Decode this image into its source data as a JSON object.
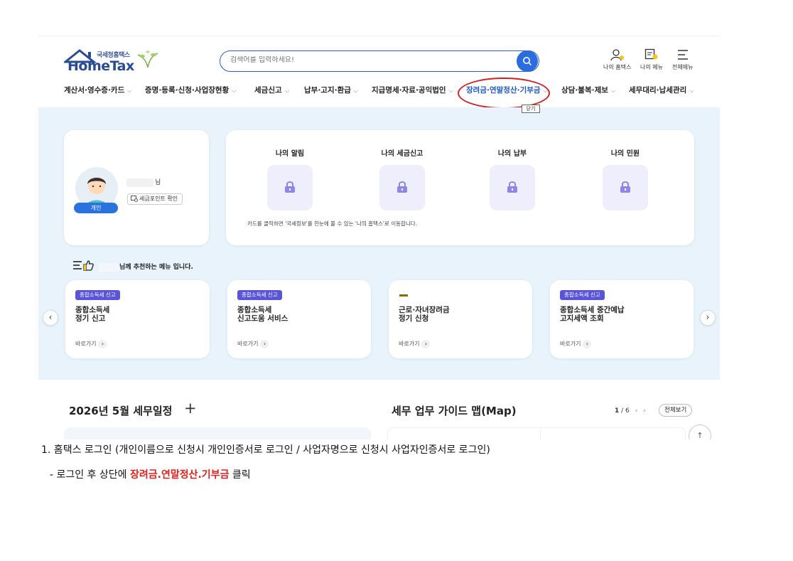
{
  "header": {
    "logo_sub": "국세청홈택스",
    "logo_main": "HomeTax",
    "search_placeholder": "검색어를 입력하세요!",
    "my_hometax": "나의 홈택스",
    "my_menu": "나의 메뉴",
    "all_menu": "전체메뉴"
  },
  "nav": {
    "items": [
      "계산서·영수증·카드",
      "증명·등록·신청·사업장현황",
      "세금신고",
      "납부·고지·환급",
      "지급명세·자료·공익법인",
      "장려금·연말정산·기부금",
      "상담·불복·제보",
      "세무대리·납세관리"
    ],
    "tooltip": "닫기"
  },
  "profile": {
    "name_suffix": "님",
    "tax_point": "세금포인트 확인",
    "badge": "개인"
  },
  "my_cards": {
    "items": [
      "나의 알림",
      "나의 세금신고",
      "나의 납부",
      "나의 민원"
    ],
    "note": "카드를 클릭하면 '국세정보'를 한눈에 볼 수 있는 '나의 홈택스'로 이동합니다."
  },
  "recommend": {
    "title_suffix": "님께 추천하는 메뉴 입니다.",
    "go_label": "바로가기",
    "cards": [
      {
        "tag": "종합소득세 신고",
        "title1": "종합소득세",
        "title2": "정기 신고"
      },
      {
        "tag": "종합소득세 신고",
        "title1": "종합소득세",
        "title2": "신고도움 서비스"
      },
      {
        "tag": "",
        "title1": "근로·자녀장려금",
        "title2": "정기 신청"
      },
      {
        "tag": "종합소득세 신고",
        "title1": "종합소득세 중간예납",
        "title2": "고지세액 조회"
      }
    ]
  },
  "bottom": {
    "schedule_title": "2026년 5월 세무일정",
    "guide_title": "세무 업무 가이드 맵(Map)",
    "pager_current": "1",
    "pager_total": "/ 6",
    "view_all": "전체보기"
  },
  "instructions": {
    "line1": "1. 홈택스 로그인 (개인이름으로 신청시 개인인증서로 로그인 / 사업자명으로 신청시 사업자인증서로 로그인)",
    "line2_prefix": "-  로그인 후 상단에 ",
    "line2_highlight": "장려금.연말정산.기부금",
    "line2_suffix": " 클릭"
  },
  "colors": {
    "accent": "#2a6de0",
    "highlight": "#e0201c",
    "panel_bg": "#e8f3fc",
    "tag_bg": "#5a55d8"
  }
}
